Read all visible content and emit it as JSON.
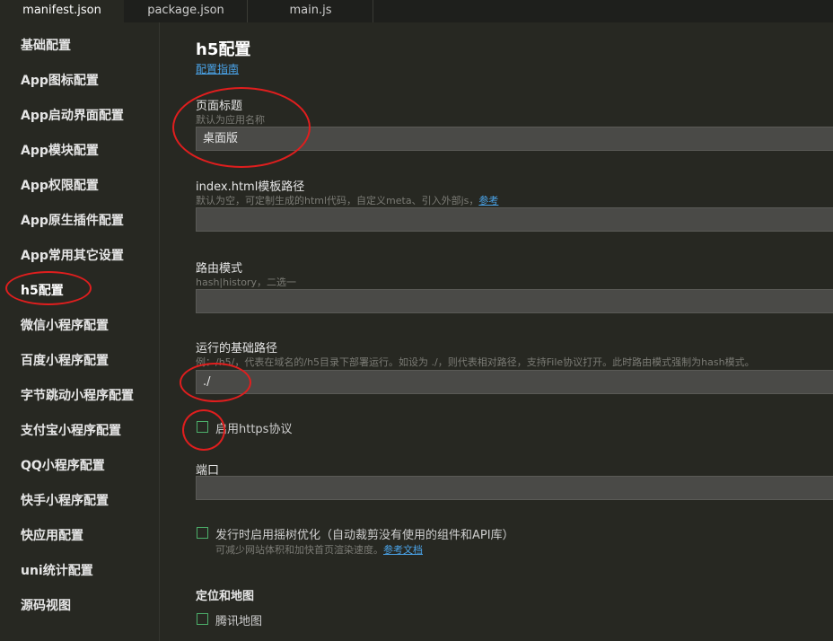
{
  "tabs": [
    {
      "label": "manifest.json",
      "active": true
    },
    {
      "label": "package.json",
      "active": false
    },
    {
      "label": "main.js",
      "active": false
    }
  ],
  "sidebar": {
    "items": [
      {
        "label": "基础配置"
      },
      {
        "label": "App图标配置"
      },
      {
        "label": "App启动界面配置"
      },
      {
        "label": "App模块配置"
      },
      {
        "label": "App权限配置"
      },
      {
        "label": "App原生插件配置"
      },
      {
        "label": "App常用其它设置"
      },
      {
        "label": "h5配置",
        "active": true
      },
      {
        "label": "微信小程序配置"
      },
      {
        "label": "百度小程序配置"
      },
      {
        "label": "字节跳动小程序配置"
      },
      {
        "label": "支付宝小程序配置"
      },
      {
        "label": "QQ小程序配置"
      },
      {
        "label": "快手小程序配置"
      },
      {
        "label": "快应用配置"
      },
      {
        "label": "uni统计配置"
      },
      {
        "label": "源码视图"
      }
    ]
  },
  "main": {
    "title": "h5配置",
    "guide_link": "配置指南",
    "page_title_field": {
      "label": "页面标题",
      "hint": "默认为应用名称",
      "value": "桌面版"
    },
    "index_template": {
      "label": "index.html模板路径",
      "hint": "默认为空，可定制生成的html代码，自定义meta、引入外部js，",
      "hint_link": "参考",
      "value": ""
    },
    "router_mode": {
      "label": "路由模式",
      "hint": "hash|history，二选一",
      "value": ""
    },
    "base_path": {
      "label": "运行的基础路径",
      "hint": "例：/h5/，代表在域名的/h5目录下部署运行。如设为 ./，则代表相对路径，支持File协议打开。此时路由模式强制为hash模式。",
      "value": "./"
    },
    "https": {
      "label": "启用https协议",
      "checked": false
    },
    "port": {
      "label": "端口",
      "value": ""
    },
    "treeshake": {
      "label": "发行时启用摇树优化（自动裁剪没有使用的组件和API库）",
      "checked": false,
      "hint": "可减少网站体积和加快首页渲染速度。",
      "hint_link": "参考文档"
    },
    "map_section": {
      "title": "定位和地图"
    },
    "tencent_map": {
      "label": "腾讯地图",
      "checked": false
    }
  },
  "colors": {
    "annotation": "#e01e1e",
    "link": "#4aa3e8",
    "checkbox": "#4caf6a",
    "background": "#272822"
  }
}
